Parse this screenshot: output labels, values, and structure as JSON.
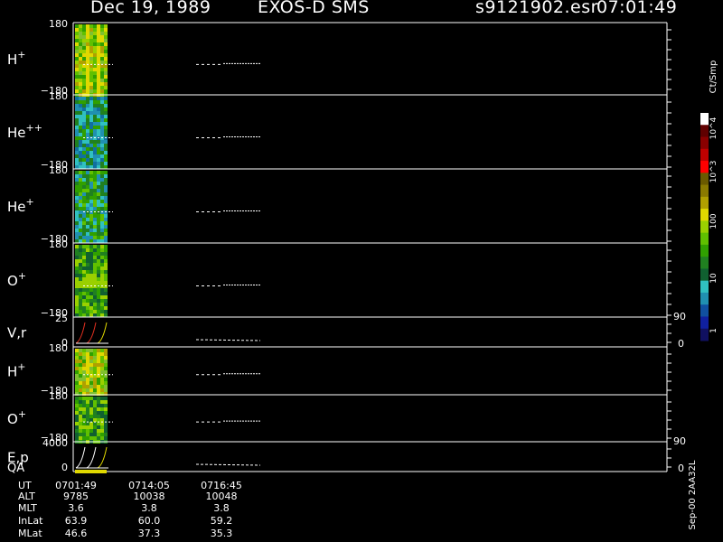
{
  "header": {
    "date": "Dec 19, 1989",
    "instrument": "EXOS-D SMS",
    "file": "s9121902.esr",
    "time": "07:01:49"
  },
  "colorbar": {
    "unit": "Ct/Smp",
    "tick_labels": [
      "10^4",
      "10^3",
      "100",
      "10",
      "1"
    ],
    "colors": [
      "#ffffff",
      "#600000",
      "#8a0000",
      "#c00000",
      "#ff0000",
      "#6a5a00",
      "#8a7a00",
      "#b0a000",
      "#e0d800",
      "#9ad000",
      "#60c000",
      "#30a000",
      "#208020",
      "#106030",
      "#30c0c0",
      "#2090b0",
      "#1050a0",
      "#1020a0",
      "#101060"
    ]
  },
  "right_axis_labels": [
    {
      "panel": "V,r",
      "top": "90",
      "bottom": "0"
    },
    {
      "panel": "E,p",
      "top": "90",
      "bottom": "0"
    }
  ],
  "vertical_note": "Sep-00 2AA32L",
  "chart_data": {
    "type": "heatmap",
    "title": "Dec 19, 1989   EXOS-D SMS",
    "panels": [
      {
        "name": "H+",
        "label": "H",
        "sup": "+",
        "ymax": "180",
        "ymin": "−180"
      },
      {
        "name": "He++",
        "label": "He",
        "sup": "++",
        "ymax": "180",
        "ymin": "−180"
      },
      {
        "name": "He+",
        "label": "He",
        "sup": "+",
        "ymax": "180",
        "ymin": "−180"
      },
      {
        "name": "O+",
        "label": "O",
        "sup": "+",
        "ymax": "180",
        "ymin": "−180"
      },
      {
        "name": "V,r",
        "label": "V,r",
        "sup": "",
        "ymax": "25",
        "ymin": "0"
      },
      {
        "name": "H+ (2)",
        "label": "H",
        "sup": "+",
        "ymax": "180",
        "ymin": "−180"
      },
      {
        "name": "O+ (2)",
        "label": "O",
        "sup": "+",
        "ymax": "180",
        "ymin": "−180"
      },
      {
        "name": "E,p",
        "label": "E,p",
        "sup": "",
        "ymax": "4000",
        "ymin": "0"
      }
    ],
    "qa_label": "QA",
    "ephemeris": {
      "row_labels": [
        "UT",
        "ALT",
        "MLT",
        "InLat",
        "MLat"
      ],
      "columns": [
        {
          "UT": "0701:49",
          "ALT": "9785",
          "MLT": "3.6",
          "InLat": "63.9",
          "MLat": "46.6"
        },
        {
          "UT": "0714:05",
          "ALT": "10038",
          "MLT": "3.8",
          "InLat": "60.0",
          "MLat": "37.3"
        },
        {
          "UT": "0716:45",
          "ALT": "10048",
          "MLT": "3.8",
          "InLat": "59.2",
          "MLat": "35.3"
        }
      ]
    }
  }
}
